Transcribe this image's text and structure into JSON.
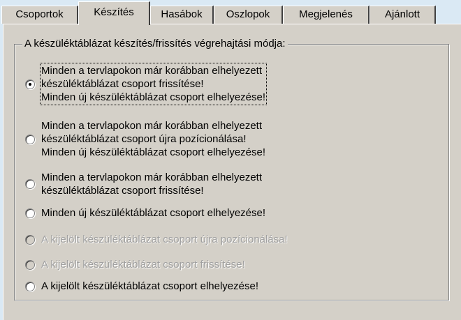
{
  "tabs": [
    {
      "label": "Csoportok"
    },
    {
      "label": "Készítés"
    },
    {
      "label": "Hasábok"
    },
    {
      "label": "Oszlopok"
    },
    {
      "label": "Megjelenés"
    },
    {
      "label": "Ajánlott"
    }
  ],
  "active_tab": "Készítés",
  "group": {
    "title": "A készüléktáblázat készítés/frissítés végrehajtási módja:"
  },
  "options": [
    {
      "lines": [
        "Minden a tervlapokon már korábban elhelyezett",
        "készüléktáblázat csoport frissítése!",
        "Minden új készüléktáblázat csoport elhelyezése!"
      ],
      "checked": true,
      "enabled": true
    },
    {
      "lines": [
        "Minden a tervlapokon már korábban elhelyezett",
        "készüléktáblázat csoport újra pozícionálása!",
        "Minden új készüléktáblázat csoport elhelyezése!"
      ],
      "checked": false,
      "enabled": true
    },
    {
      "lines": [
        "Minden a tervlapokon már korábban elhelyezett",
        "készüléktáblázat csoport frissítése!"
      ],
      "checked": false,
      "enabled": true
    },
    {
      "lines": [
        "Minden új készüléktáblázat csoport elhelyezése!"
      ],
      "checked": false,
      "enabled": true
    },
    {
      "lines": [
        "A kijelölt készüléktáblázat csoport újra pozícionálása!"
      ],
      "checked": false,
      "enabled": false
    },
    {
      "lines": [
        "A kijelölt készüléktáblázat csoport frissítése!"
      ],
      "checked": false,
      "enabled": false
    },
    {
      "lines": [
        "A kijelölt készüléktáblázat csoport elhelyezése!"
      ],
      "checked": false,
      "enabled": true
    }
  ]
}
